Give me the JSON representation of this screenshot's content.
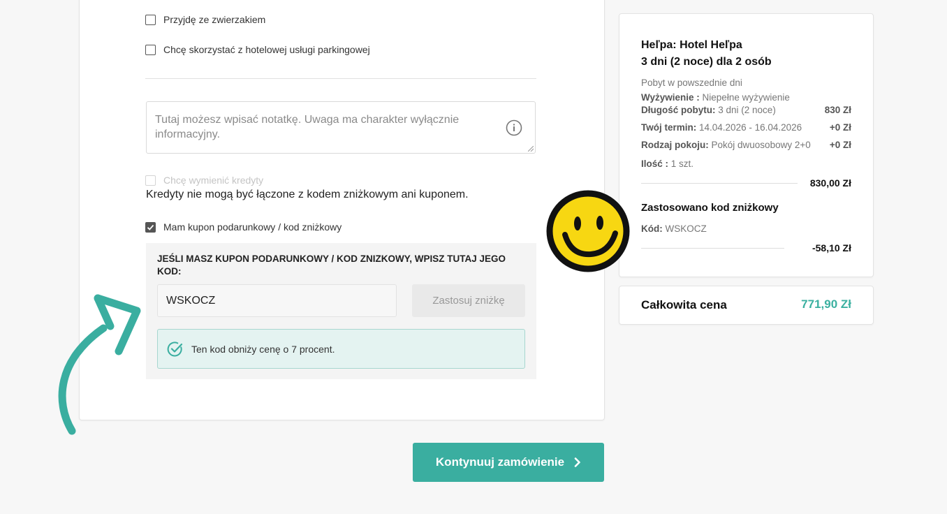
{
  "form": {
    "options": [
      {
        "label": "Przyjdę ze zwierzakiem",
        "checked": false
      },
      {
        "label": "Chcę skorzystać z hotelowej usługi parkingowej",
        "checked": false
      }
    ],
    "note_placeholder": "Tutaj możesz wpisać notatkę. Uwaga ma charakter wyłącznie informacyjny.",
    "credits_label": "Chcę wymienić kredyty",
    "credits_note": "Kredyty nie mogą być łączone z kodem zniżkowym ani kuponem.",
    "coupon_checkbox_label": "Mam kupon podarunkowy / kod zniżkowy",
    "coupon_heading": "JEŚLI MASZ KUPON PODARUNKOWY / KOD ZNIZKOWY, WPISZ TUTAJ JEGO KOD:",
    "coupon_value": "WSKOCZ",
    "apply_label": "Zastosuj zniżkę",
    "success_message": "Ten kod obniży cenę o 7 procent."
  },
  "summary": {
    "title_line1": "Heľpa: Hotel Heľpa",
    "title_line2": "3 dni (2 noce) dla 2 osób",
    "stay_type": "Pobyt w powszednie dni",
    "rows": [
      {
        "key": "Wyżywienie :",
        "value": "Niepełne wyżywienie",
        "price": ""
      },
      {
        "key": "Długość pobytu:",
        "value": "3 dni (2 noce)",
        "price": "830 Zł"
      },
      {
        "key": "Twój termin:",
        "value": "14.04.2026 - 16.04.2026",
        "price": "+0 Zł"
      },
      {
        "key": "Rodzaj pokoju:",
        "value": "Pokój dwuosobowy 2+0",
        "price": "+0 Zł"
      },
      {
        "key": "Ilość :",
        "value": "1 szt.",
        "price": ""
      }
    ],
    "subtotal": "830,00 Zł",
    "discount_title": "Zastosowano kod zniżkowy",
    "discount_code_key": "Kód:",
    "discount_code_value": "WSKOCZ",
    "discount_amount": "-58,10 Zł"
  },
  "total": {
    "label": "Całkowita cena",
    "value": "771,90 Zł"
  },
  "continue_label": "Kontynuuj zamówienie",
  "colors": {
    "accent": "#3aaea0",
    "total_value": "#3bb0a0",
    "success_bg": "#e4f3f1"
  },
  "icons": [
    "info-icon",
    "check-circle-icon",
    "chevron-right-icon",
    "smiley-icon",
    "arrow-annotation-icon"
  ]
}
